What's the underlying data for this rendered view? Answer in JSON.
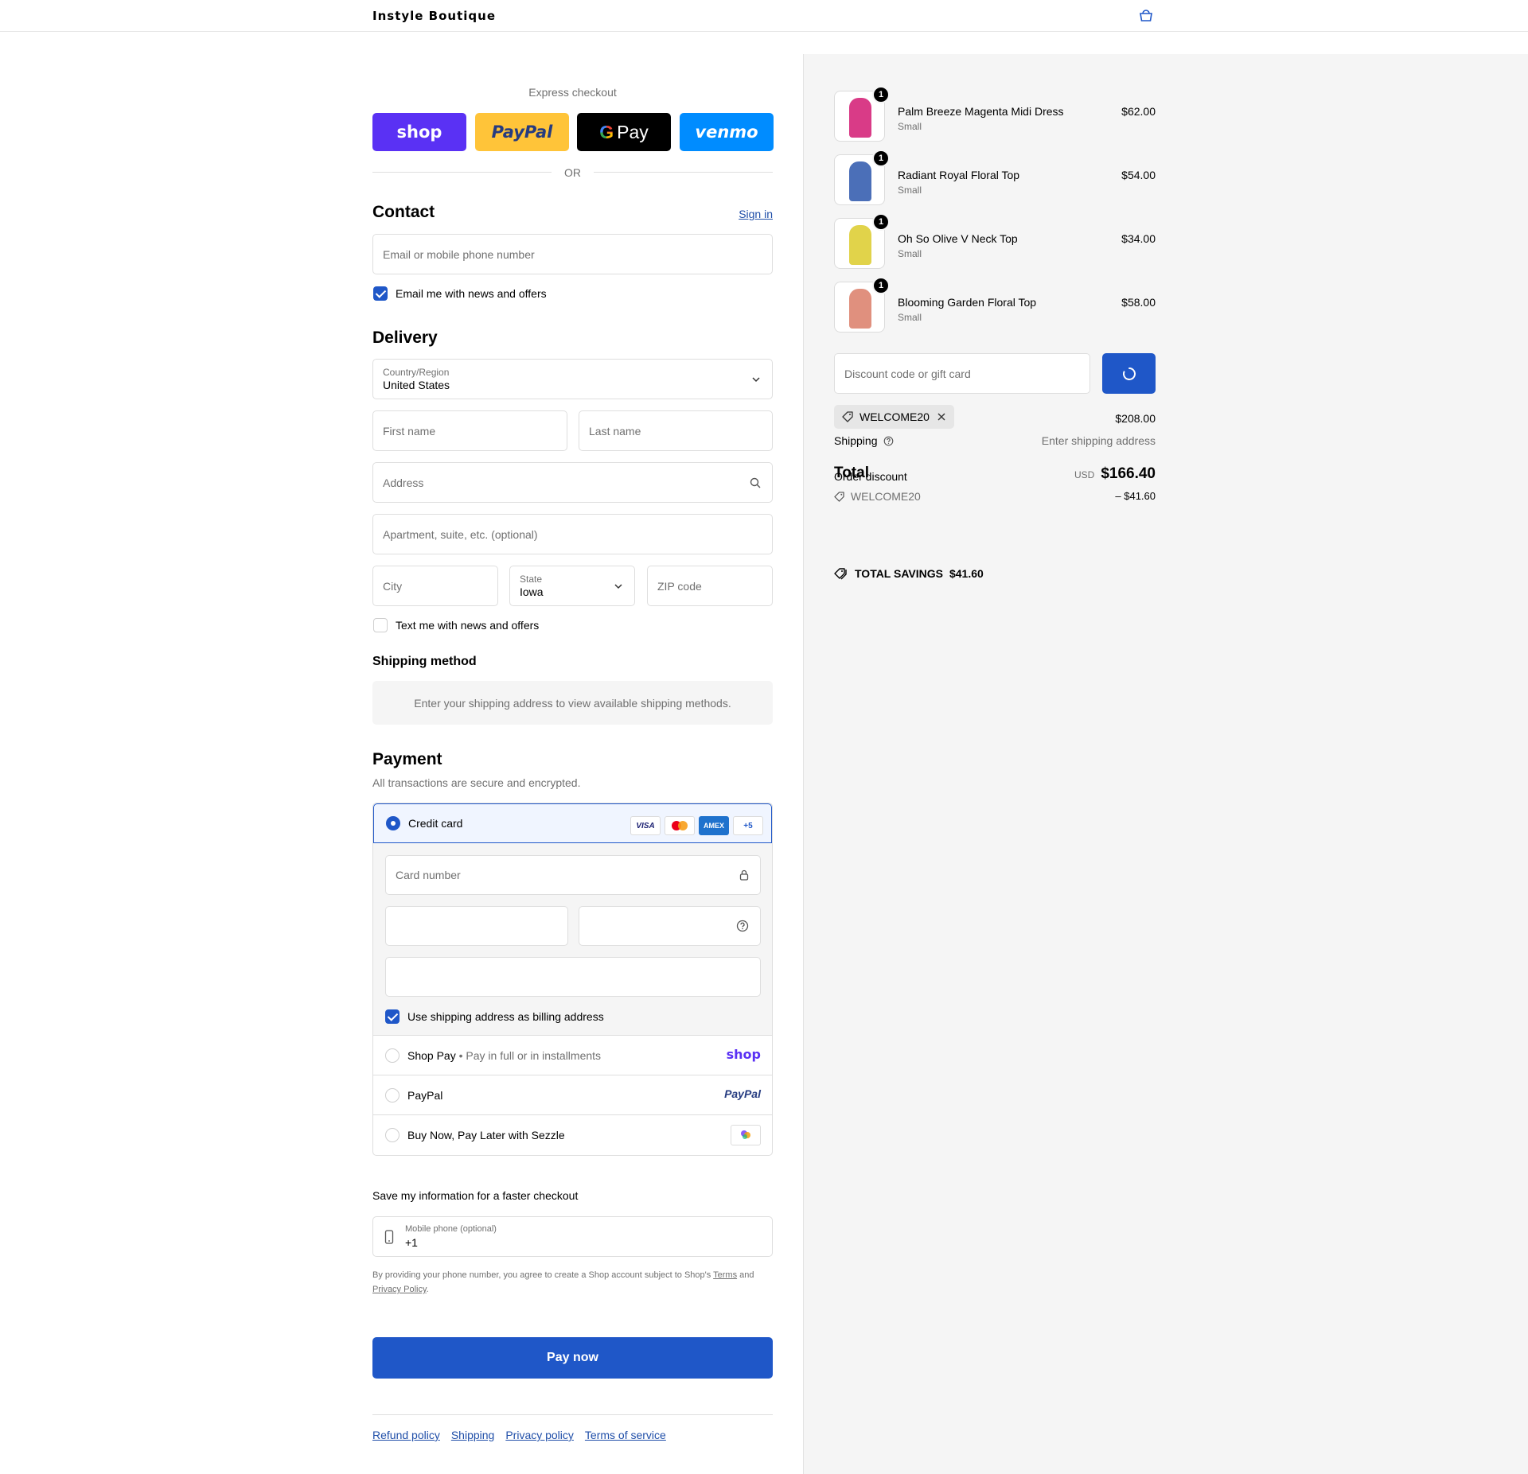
{
  "header": {
    "brand": "Instyle Boutique",
    "cart_icon": "bag-icon"
  },
  "express": {
    "title": "Express checkout",
    "buttons": {
      "shop": "shop",
      "paypal": "PayPal",
      "gpay": "Pay",
      "venmo": "venmo"
    },
    "or": "OR"
  },
  "contact": {
    "heading": "Contact",
    "sign_in": "Sign in",
    "email_placeholder": "Email or mobile phone number",
    "news_label": "Email me with news and offers",
    "news_checked": true
  },
  "delivery": {
    "heading": "Delivery",
    "country_label": "Country/Region",
    "country_value": "United States",
    "first_name": "First name",
    "last_name": "Last name",
    "address": "Address",
    "apartment": "Apartment, suite, etc. (optional)",
    "city": "City",
    "state_label": "State",
    "state_value": "Iowa",
    "zip": "ZIP code",
    "text_label": "Text me with news and offers",
    "text_checked": false
  },
  "shipping_method": {
    "heading": "Shipping method",
    "info": "Enter your shipping address to view available shipping methods."
  },
  "payment": {
    "heading": "Payment",
    "subtitle": "All transactions are secure and encrypted.",
    "credit_card_label": "Credit card",
    "card_logos": [
      "VISA",
      "MC",
      "AMEX",
      "+5"
    ],
    "card_number": "Card number",
    "billing_label": "Use shipping address as billing address",
    "billing_checked": true,
    "options": [
      {
        "label": "Shop Pay",
        "sub": "Pay in full or in installments",
        "brand": "shop"
      },
      {
        "label": "PayPal",
        "sub": "",
        "brand": "PayPal"
      },
      {
        "label": "Buy Now, Pay Later with Sezzle",
        "sub": "",
        "brand": "sezzle-icon"
      }
    ]
  },
  "save_info": {
    "heading": "Save my information for a faster checkout",
    "phone_label": "Mobile phone (optional)",
    "phone_value": "+1",
    "disclaimer_1": "By providing your phone number, you agree to create a Shop account subject to Shop's",
    "terms": "Terms",
    "and": "and",
    "privacy": "Privacy Policy",
    "period": "."
  },
  "pay_now": "Pay now",
  "footer": [
    "Refund policy",
    "Shipping",
    "Privacy policy",
    "Terms of service"
  ],
  "summary": {
    "items": [
      {
        "name": "Palm Breeze Magenta Midi Dress",
        "variant": "Small",
        "price": "$62.00",
        "qty": "1",
        "color": "#d93b87"
      },
      {
        "name": "Radiant Royal Floral Top",
        "variant": "Small",
        "price": "$54.00",
        "qty": "1",
        "color": "#4b6fb8"
      },
      {
        "name": "Oh So Olive V Neck Top",
        "variant": "Small",
        "price": "$34.00",
        "qty": "1",
        "color": "#e1d34a"
      },
      {
        "name": "Blooming Garden Floral Top",
        "variant": "Small",
        "price": "$58.00",
        "qty": "1",
        "color": "#e0907e"
      }
    ],
    "discount_placeholder": "Discount code or gift card",
    "applied_code": "WELCOME20",
    "subtotal": "$208.00",
    "shipping_label": "Shipping",
    "shipping_value": "Enter shipping address",
    "order_discount_label": "Order discount",
    "total_label": "Total",
    "currency": "USD",
    "total": "$166.40",
    "discount_code": "WELCOME20",
    "discount_amount": "– $41.60",
    "savings_label": "TOTAL SAVINGS",
    "savings_value": "$41.60"
  },
  "colors": {
    "accent": "#1f57c8",
    "shop": "#5a31f4",
    "paypal": "#ffc439",
    "venmo": "#008cff"
  }
}
